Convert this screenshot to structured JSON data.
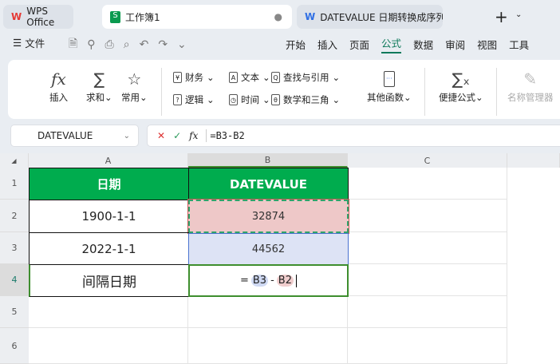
{
  "tabs": [
    {
      "label": "WPS Office"
    },
    {
      "label": "工作簿1"
    },
    {
      "label": "DATEVALUE 日期转换成序列号-WPS"
    }
  ],
  "menu": {
    "file": "文件",
    "tabs": [
      "开始",
      "插入",
      "页面",
      "公式",
      "数据",
      "审阅",
      "视图",
      "工具"
    ],
    "active": "公式"
  },
  "ribbon": {
    "insert": "插入",
    "sum": "求和",
    "common": "常用",
    "finance": "财务",
    "text": "文本",
    "lookup": "查找与引用",
    "logic": "逻辑",
    "time": "时间",
    "math": "数学和三角",
    "other": "其他函数",
    "quick": "便捷公式",
    "names": "名称管理器"
  },
  "formula_bar": {
    "name_box": "DATEVALUE",
    "formula": "=B3-B2"
  },
  "columns": [
    "A",
    "B",
    "C"
  ],
  "rows": [
    "1",
    "2",
    "3",
    "4",
    "5",
    "6"
  ],
  "cells": {
    "A1": "日期",
    "B1": "DATEVALUE",
    "A2": "1900-1-1",
    "B2": "32874",
    "A3": "2022-1-1",
    "B3": "44562",
    "A4": "间隔日期",
    "B4_eq": "=",
    "B4_ref1": "B3",
    "B4_op": "-",
    "B4_ref2": "B2"
  },
  "colors": {
    "header_green": "#00ac4e",
    "b2_fill": "#eec8c8",
    "b3_fill": "#dde3f5"
  }
}
